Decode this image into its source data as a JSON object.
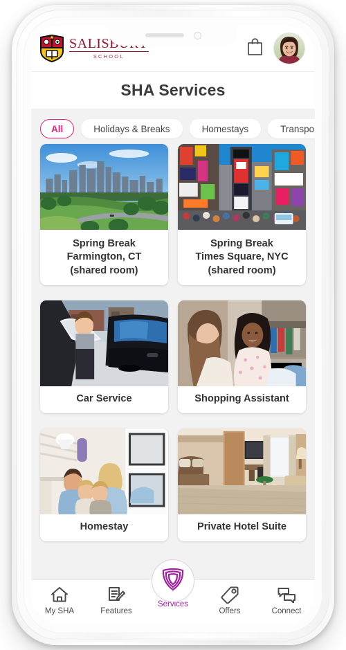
{
  "device": {
    "frame": "iphone-white",
    "notch_icons": [
      "speaker-grille",
      "front-camera"
    ]
  },
  "header": {
    "logo_name": "SALISBURY",
    "logo_sub": "SCHOOL",
    "logo_icon": "salisbury-school-crest-icon",
    "bag_icon": "shopping-bag-icon",
    "avatar_icon": "user-avatar"
  },
  "title_bar": {
    "title": "SHA Services"
  },
  "filters": {
    "chips": [
      {
        "label": "All",
        "active": true
      },
      {
        "label": "Holidays & Breaks",
        "active": false
      },
      {
        "label": "Homestays",
        "active": false
      },
      {
        "label": "Transportation",
        "active": false
      }
    ]
  },
  "services": {
    "cards": [
      {
        "title": "Spring Break\nFarmington, CT\n(shared room)",
        "image": "city-skyline-park-photo"
      },
      {
        "title": "Spring Break\nTimes Square, NYC\n(shared room)",
        "image": "times-square-photo"
      },
      {
        "title": "Car Service",
        "image": "chauffeur-car-photo"
      },
      {
        "title": "Shopping Assistant",
        "image": "two-women-shopping-photo"
      },
      {
        "title": "Homestay",
        "image": "host-family-photo"
      },
      {
        "title": "Private Hotel Suite",
        "image": "hotel-suite-photo"
      }
    ]
  },
  "tabbar": {
    "items": [
      {
        "label": "My SHA",
        "icon": "home-icon",
        "active": false
      },
      {
        "label": "Features",
        "icon": "document-pencil-icon",
        "active": false
      },
      {
        "label": "Services",
        "icon": "shield-icon",
        "active": true
      },
      {
        "label": "Offers",
        "icon": "price-tag-icon",
        "active": false
      },
      {
        "label": "Connect",
        "icon": "chat-bubbles-icon",
        "active": false
      }
    ]
  },
  "colors": {
    "accent_pink": "#ec1e79",
    "accent_purple": "#a0219f",
    "brand_red": "#9d1228",
    "screen_bg": "#f2f2f2",
    "text_dark": "#333333"
  }
}
